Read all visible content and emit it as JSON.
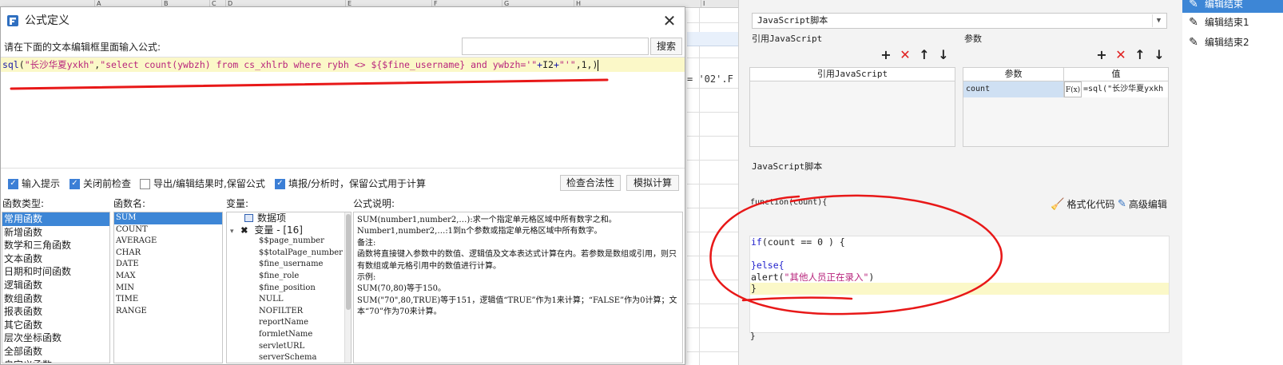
{
  "sheet": {
    "columns": [
      "A",
      "B",
      "C",
      "D",
      "E",
      "F",
      "G",
      "H",
      "I"
    ],
    "formula_fragment": "= '02'.F"
  },
  "dialog": {
    "title": "公式定义",
    "prompt": "请在下面的文本编辑框里面输入公式:",
    "search_placeholder": "",
    "search_label": "搜索",
    "formula": {
      "fn": "sql",
      "open": "(",
      "arg1": "\"长沙华夏yxkh\"",
      "comma": ",",
      "arg2a": "\"select count(ywbzh) from cs_xhlrb where rybh <> ${$fine_username} and ywbzh='\"",
      "plus1": "+",
      "ref": "I2",
      "plus2": "+",
      "arg2b": "\"'\"",
      "tail": ",1,)"
    },
    "options": [
      {
        "label": "输入提示",
        "checked": true
      },
      {
        "label": "关闭前检查",
        "checked": true
      },
      {
        "label": "导出/编辑结果时,保留公式",
        "checked": false
      },
      {
        "label": "填报/分析时，保留公式用于计算",
        "checked": true
      }
    ],
    "check_button": "检查合法性",
    "simulate_button": "模拟计算",
    "func_type_label": "函数类型:",
    "func_types": [
      "常用函数",
      "新增函数",
      "数学和三角函数",
      "文本函数",
      "日期和时间函数",
      "逻辑函数",
      "数组函数",
      "报表函数",
      "其它函数",
      "层次坐标函数",
      "全部函数",
      "自定义函数"
    ],
    "func_name_label": "函数名:",
    "func_names": [
      "SUM",
      "COUNT",
      "AVERAGE",
      "CHAR",
      "DATE",
      "MAX",
      "MIN",
      "TIME",
      "RANGE"
    ],
    "var_label": "变量:",
    "var_root_dataitem": "数据项",
    "var_root_variables": "变量 - [16]",
    "variables": [
      "$$page_number",
      "$$totalPage_number",
      "$fine_username",
      "$fine_role",
      "$fine_position",
      "NULL",
      "NOFILTER",
      "reportName",
      "formletName",
      "servletURL",
      "serverSchema"
    ],
    "desc_label": "公式说明:",
    "desc_lines": [
      "SUM(number1,number2,…):求一个指定单元格区域中所有数字之和。",
      "Number1,number2,…:1到n个参数或指定单元格区域中所有数字。",
      "备注:",
      "函数将直接键入参数中的数值、逻辑值及文本表达式计算在内。若参数是数组或引用，则只有数组或单元格引用中的数值进行计算。",
      "示例:",
      "SUM(70,80)等于150。",
      "SUM(\"70\",80,TRUE)等于151，逻辑值“TRUE”作为1来计算；“FALSE”作为0计算；文本“70”作为70来计算。"
    ]
  },
  "right_panel": {
    "script_type": "JavaScript脚本",
    "ref_js_label": "引用JavaScript",
    "params_label": "参数",
    "ref_js_column": "引用JavaScript",
    "param_col_name": "参数",
    "param_col_value": "值",
    "param_row": {
      "name": "count",
      "value": "=sql(\"长沙华夏yxkh"
    },
    "fx_label": "F(x)",
    "js_script_label": "JavaScript脚本",
    "format_code": "格式化代码",
    "advanced_edit": "高级编辑",
    "code_header": "function(count){",
    "code_lines": [
      {
        "a": "",
        "b": "",
        "c": ""
      },
      {
        "a": "if",
        "b": "(count == 0 ) {",
        "c": ""
      },
      {
        "a": "",
        "b": "",
        "c": ""
      },
      {
        "a": "",
        "b": "}else{",
        "c": ""
      },
      {
        "a": "",
        "b": "alert(",
        "c": "\"其他人员正在录入\"",
        "d": ")"
      },
      {
        "a": "",
        "b": "}",
        "c": ""
      }
    ],
    "code_footer": "}"
  },
  "far_right": {
    "items": [
      "编辑结束",
      "编辑结束1",
      "编辑结束2"
    ]
  },
  "colors": {
    "accent": "#3d86d6",
    "annotation": "#e81818",
    "highlight": "#fbf8c8"
  }
}
